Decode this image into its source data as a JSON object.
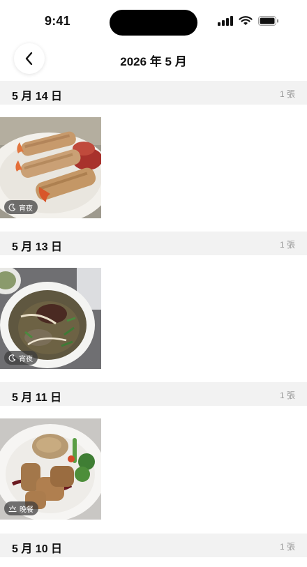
{
  "status_bar": {
    "time": "9:41"
  },
  "header": {
    "title": "2026 年 5 月",
    "back_icon": "chevron-left-icon"
  },
  "sections": [
    {
      "date": "5 月 14 日",
      "count": "1 張",
      "photo": {
        "subject": "shrimp-rolls",
        "meal": "宵夜",
        "meal_icon": "moon-icon"
      }
    },
    {
      "date": "5 月 13 日",
      "count": "1 張",
      "photo": {
        "subject": "pho-soup",
        "meal": "宵夜",
        "meal_icon": "moon-icon"
      }
    },
    {
      "date": "5 月 11 日",
      "count": "1 張",
      "photo": {
        "subject": "chicken-rice-plate",
        "meal": "晚餐",
        "meal_icon": "sunset-icon"
      }
    },
    {
      "date": "5 月 10 日",
      "count": "1 張"
    }
  ]
}
